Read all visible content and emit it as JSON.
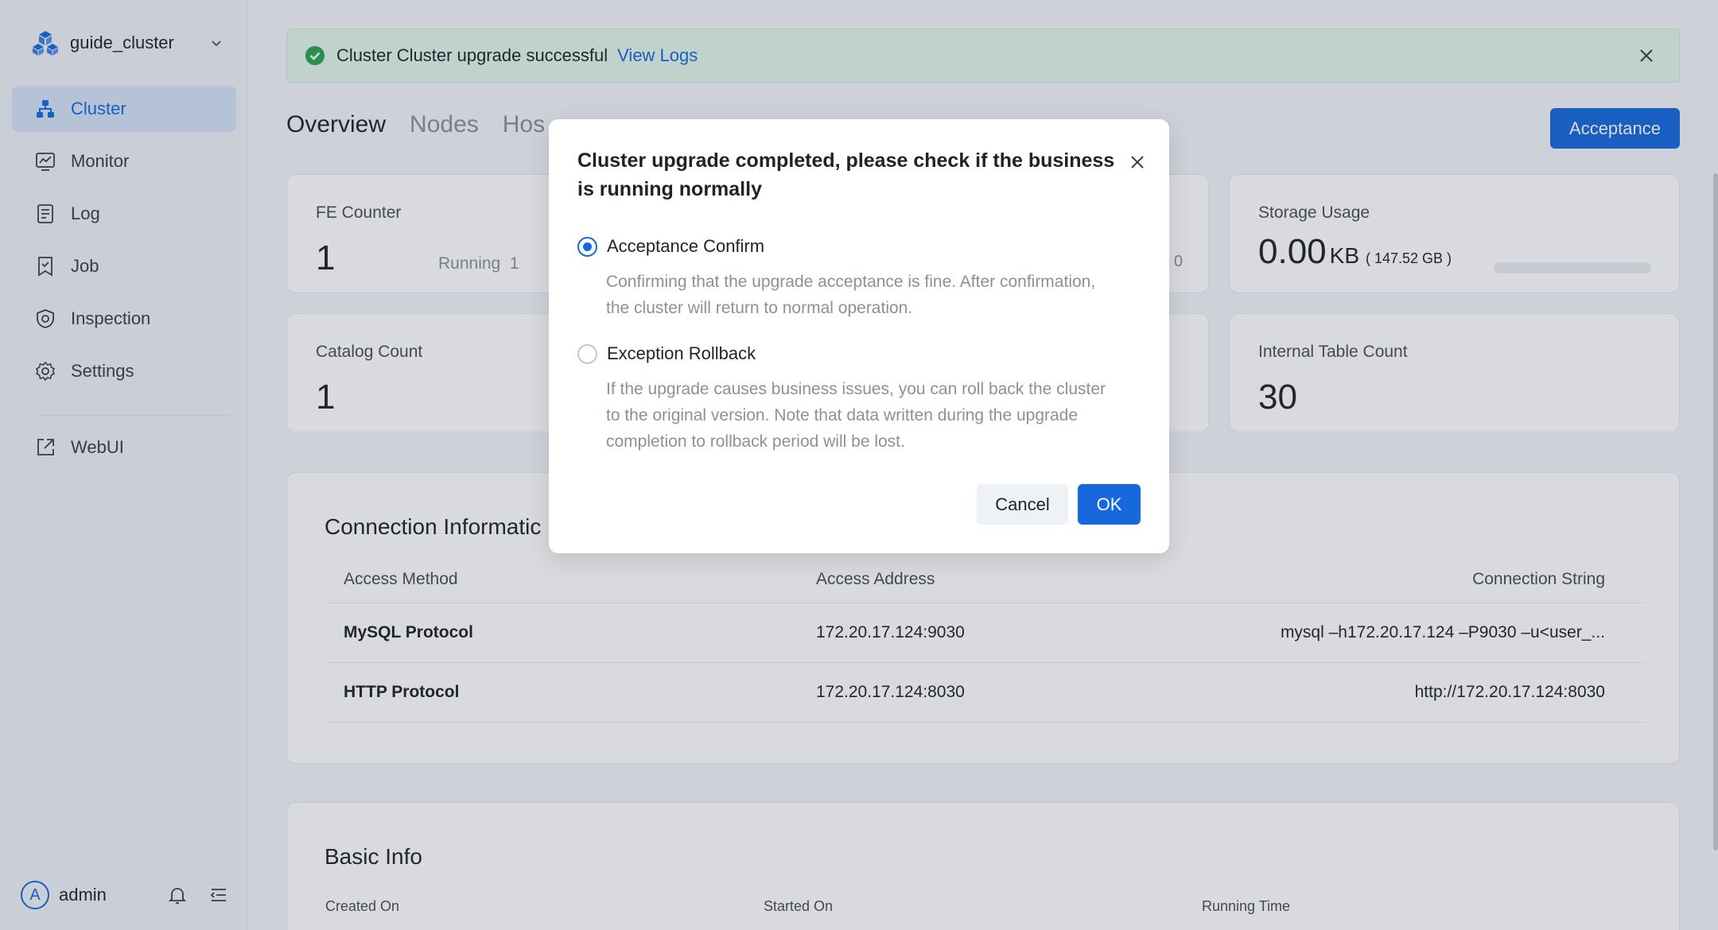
{
  "sidebar": {
    "cluster_name": "guide_cluster",
    "items": [
      {
        "label": "Cluster",
        "icon": "cluster-icon",
        "active": true
      },
      {
        "label": "Monitor",
        "icon": "monitor-icon"
      },
      {
        "label": "Log",
        "icon": "log-icon"
      },
      {
        "label": "Job",
        "icon": "job-icon"
      },
      {
        "label": "Inspection",
        "icon": "inspection-icon"
      },
      {
        "label": "Settings",
        "icon": "gear-icon"
      }
    ],
    "webui": "WebUI",
    "user": {
      "initial": "A",
      "name": "admin"
    }
  },
  "alert": {
    "message": "Cluster Cluster upgrade successful",
    "link": "View Logs"
  },
  "tabs": [
    "Overview",
    "Nodes",
    "Hos"
  ],
  "acceptance_button": "Acceptance",
  "cards": {
    "fe": {
      "label": "FE Counter",
      "value": "1",
      "running_label": "Running",
      "running_value": "1"
    },
    "storage": {
      "label": "Storage Usage",
      "value": "0.00",
      "unit": "KB",
      "sub": "( 147.52 GB )"
    },
    "catalog": {
      "label": "Catalog Count",
      "value": "1"
    },
    "internal": {
      "label": "Internal Table Count",
      "value": "30"
    },
    "partial_value": "0"
  },
  "connection": {
    "title": "Connection Informatic",
    "headers": [
      "Access Method",
      "Access Address",
      "Connection String"
    ],
    "rows": [
      [
        "MySQL Protocol",
        "172.20.17.124:9030",
        "mysql –h172.20.17.124 –P9030 –u<user_..."
      ],
      [
        "HTTP Protocol",
        "172.20.17.124:8030",
        "http://172.20.17.124:8030"
      ]
    ]
  },
  "basic_info": {
    "title": "Basic Info",
    "labels": [
      "Created On",
      "Started On",
      "Running Time"
    ]
  },
  "modal": {
    "title": "Cluster upgrade completed, please check if the business is running normally",
    "option1": {
      "label": "Acceptance Confirm",
      "desc": "Confirming that the upgrade acceptance is fine. After confirmation, the cluster will return to normal operation."
    },
    "option2": {
      "label": "Exception Rollback",
      "desc": "If the upgrade causes business issues, you can roll back the cluster to the original version. Note that data written during the upgrade completion to rollback period will be lost."
    },
    "cancel": "Cancel",
    "ok": "OK"
  },
  "colors": {
    "accent": "#1668dc",
    "success": "#2ba34e",
    "alert_bg": "#e3f4e8"
  }
}
